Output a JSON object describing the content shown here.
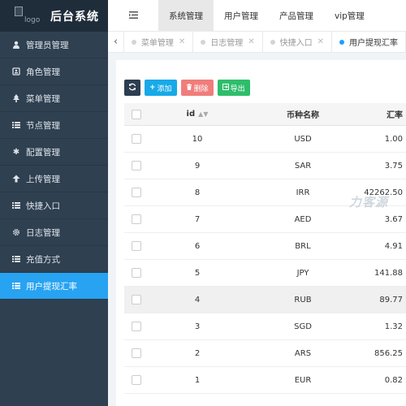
{
  "app": {
    "title": "后台系统",
    "logo_alt": "logo"
  },
  "sidebar": {
    "items": [
      {
        "label": "管理员管理",
        "icon": "user-icon"
      },
      {
        "label": "角色管理",
        "icon": "id-card-icon"
      },
      {
        "label": "菜单管理",
        "icon": "tree-icon"
      },
      {
        "label": "节点管理",
        "icon": "list-icon"
      },
      {
        "label": "配置管理",
        "icon": "asterisk-icon"
      },
      {
        "label": "上传管理",
        "icon": "arrow-up-icon"
      },
      {
        "label": "快捷入口",
        "icon": "list-icon"
      },
      {
        "label": "日志管理",
        "icon": "gear-icon"
      },
      {
        "label": "充值方式",
        "icon": "list-icon"
      },
      {
        "label": "用户提现汇率",
        "icon": "list-icon",
        "active": true
      }
    ]
  },
  "topnav": {
    "toggle_icon": "menu-icon",
    "items": [
      {
        "label": "系统管理",
        "active": true
      },
      {
        "label": "用户管理"
      },
      {
        "label": "产品管理"
      },
      {
        "label": "vip管理"
      }
    ]
  },
  "tabs": [
    {
      "label": "菜单管理"
    },
    {
      "label": "日志管理"
    },
    {
      "label": "快捷入口"
    },
    {
      "label": "用户提现汇率",
      "active": true
    }
  ],
  "toolbar": {
    "refresh_icon": "refresh-icon",
    "add_label": "添加",
    "delete_label": "删除",
    "export_label": "导出"
  },
  "table": {
    "headers": {
      "id": "id",
      "currency": "币种名称",
      "rate": "汇率"
    },
    "rows": [
      {
        "id": "10",
        "currency": "USD",
        "rate": "1.00"
      },
      {
        "id": "9",
        "currency": "SAR",
        "rate": "3.75"
      },
      {
        "id": "8",
        "currency": "IRR",
        "rate": "42262.50"
      },
      {
        "id": "7",
        "currency": "AED",
        "rate": "3.67"
      },
      {
        "id": "6",
        "currency": "BRL",
        "rate": "4.91"
      },
      {
        "id": "5",
        "currency": "JPY",
        "rate": "141.88"
      },
      {
        "id": "4",
        "currency": "RUB",
        "rate": "89.77",
        "highlighted": true
      },
      {
        "id": "3",
        "currency": "SGD",
        "rate": "1.32"
      },
      {
        "id": "2",
        "currency": "ARS",
        "rate": "856.25"
      },
      {
        "id": "1",
        "currency": "EUR",
        "rate": "0.82"
      }
    ]
  },
  "watermark": "力客源"
}
